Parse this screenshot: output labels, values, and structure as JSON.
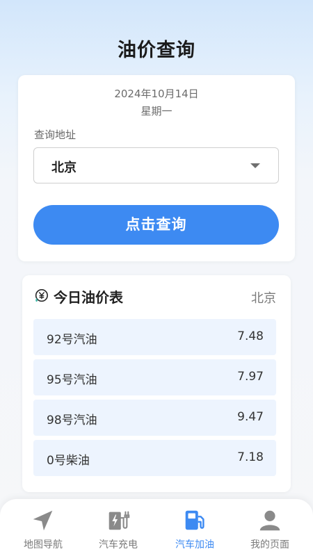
{
  "header": {
    "title": "油价查询"
  },
  "query": {
    "date": "2024年10月14日",
    "weekday": "星期一",
    "address_label": "查询地址",
    "selected_city": "北京",
    "button_label": "点击查询"
  },
  "prices": {
    "title": "今日油价表",
    "city": "北京",
    "rows": [
      {
        "name": "92号汽油",
        "price": "7.48"
      },
      {
        "name": "95号汽油",
        "price": "7.97"
      },
      {
        "name": "98号汽油",
        "price": "9.47"
      },
      {
        "name": "0号柴油",
        "price": "7.18"
      }
    ]
  },
  "tabs": [
    {
      "label": "地图导航",
      "icon": "navigation-icon"
    },
    {
      "label": "汽车充电",
      "icon": "ev-charger-icon"
    },
    {
      "label": "汽车加油",
      "icon": "gas-pump-icon",
      "active": true
    },
    {
      "label": "我的页面",
      "icon": "user-icon"
    }
  ],
  "colors": {
    "accent": "#3d8af2",
    "inactive": "#8a8a8a",
    "row_background": "#edf4fe"
  }
}
